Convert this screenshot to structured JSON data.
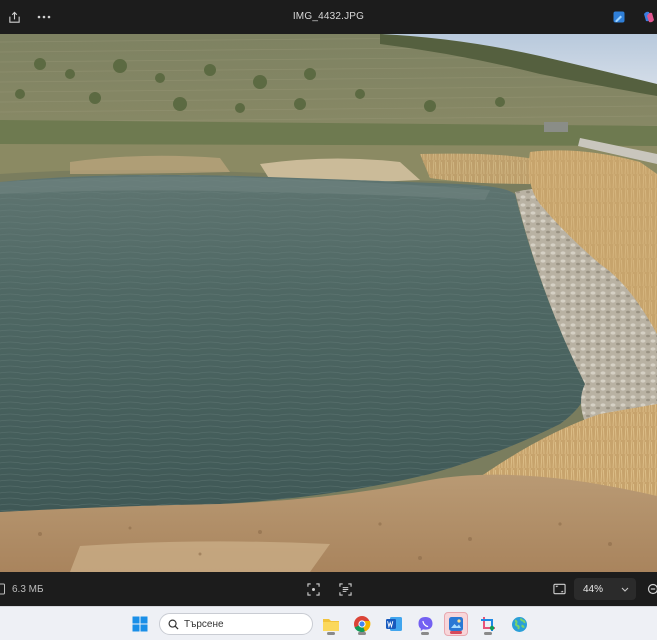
{
  "window": {
    "title": "IMG_4432.JPG"
  },
  "photo": {
    "description_icon": "photo-image"
  },
  "bottombar": {
    "file_size": "6.3 МБ",
    "zoom": "44%"
  },
  "taskbar": {
    "search_placeholder": "Търсене",
    "apps": [
      "windows-start",
      "file-explorer",
      "chrome",
      "word",
      "viber",
      "photos",
      "snipping-tool",
      "world-map-app"
    ]
  },
  "colors": {
    "bar_bg": "#1c1c1c",
    "taskbar_bg": "#eef0f5",
    "active_accent": "#d64a5c"
  }
}
